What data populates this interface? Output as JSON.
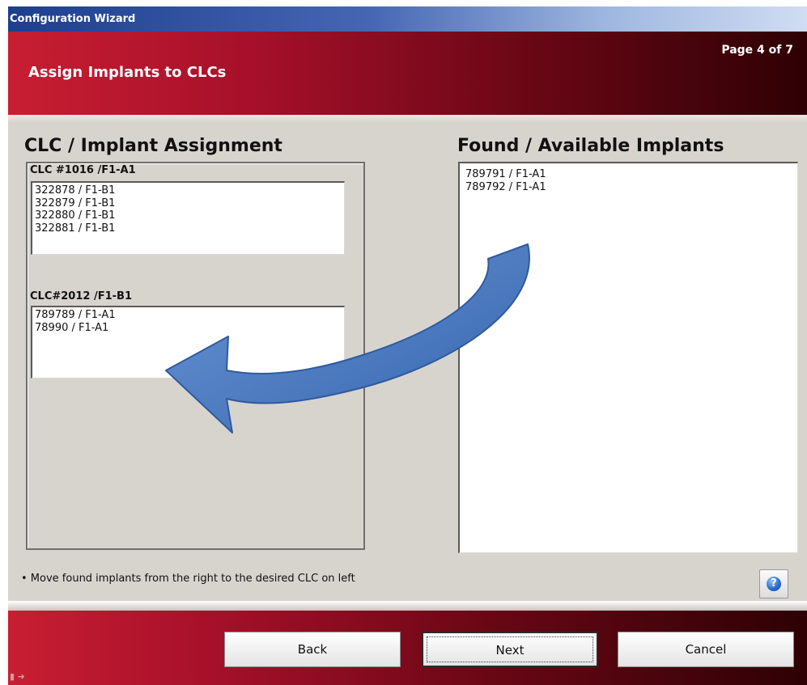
{
  "window": {
    "title": "Configuration Wizard"
  },
  "header": {
    "title": "Assign Implants to CLCs",
    "page_indicator": "Page 4 of 7"
  },
  "left_panel": {
    "title": "CLC / Implant Assignment",
    "groups": [
      {
        "label": "CLC #1016 /F1-A1",
        "items": [
          "322878 / F1-B1",
          "322879 / F1-B1",
          "322880 / F1-B1",
          "322881 / F1-B1"
        ]
      },
      {
        "label": "CLC#2012 /F1-B1",
        "items": [
          "789789 / F1-A1",
          "78990 / F1-A1"
        ]
      }
    ]
  },
  "right_panel": {
    "title": "Found / Available Implants",
    "items": [
      "789791 / F1-A1",
      "789792 / F1-A1"
    ]
  },
  "hint": "• Move found implants from the right to the desired CLC on left",
  "help_icon": "question-mark-icon",
  "buttons": {
    "back": "Back",
    "next": "Next",
    "cancel": "Cancel"
  },
  "colors": {
    "header_red": "#a7102a",
    "titlebar_blue": "#1c3f8f",
    "arrow_blue": "#4a7ac0"
  }
}
